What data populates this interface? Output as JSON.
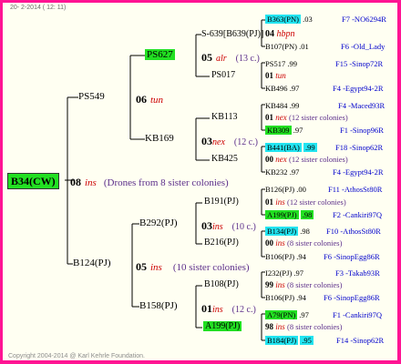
{
  "header": "20-  2-2014 ( 12: 11)",
  "copyright": "Copyright 2004-2014 @ Karl Kehrle Foundation.",
  "root": {
    "label": "B34(CW)",
    "gen": "08",
    "breed": "ins",
    "note": "(Drones from 8 sister colonies)"
  },
  "gen1": {
    "a": {
      "label": "PS549",
      "gen": "06",
      "breed": "tun"
    },
    "b": {
      "label": "B124(PJ)",
      "gen": "05",
      "breed": "ins",
      "note": "(10 sister colonies)"
    }
  },
  "gen2": {
    "ps627": {
      "label": "PS627",
      "gen": "05",
      "breed": "alr",
      "note": "(13 c.)"
    },
    "kb169": {
      "label": "KB169",
      "gen": "03",
      "breed": "nex",
      "note": "(12 c.)"
    },
    "b292": {
      "label": "B292(PJ)",
      "gen": "03",
      "breed": "ins",
      "note": "(10 c.)"
    },
    "b158": {
      "label": "B158(PJ)",
      "gen": "01",
      "breed": "ins",
      "note": "(12 c.)"
    }
  },
  "gen3": {
    "s639": {
      "label": "S-639[B639(PJ)]",
      "gen": "04",
      "breed": "hbpn"
    },
    "ps017": {
      "label": "PS017",
      "gen": "01",
      "breed": "tun"
    },
    "kb113": {
      "label": "KB113",
      "gen": "01",
      "breed": "nex",
      "note": "(12 sister colonies)"
    },
    "kb425": {
      "label": "KB425",
      "gen": "00",
      "breed": "nex",
      "note": "(12 sister colonies)"
    },
    "b191": {
      "label": "B191(PJ)",
      "gen": "01",
      "breed": "ins",
      "note": "(12 sister colonies)"
    },
    "b216": {
      "label": "B216(PJ)",
      "gen": "00",
      "breed": "ins",
      "note": "(8 sister colonies)"
    },
    "b108": {
      "label": "B108(PJ)",
      "gen": "99",
      "breed": "ins",
      "note": "(8 sister colonies)"
    },
    "a199": {
      "label": "A199(PJ)",
      "gen": "98",
      "breed": "ins",
      "note": "(8 sister colonies)"
    }
  },
  "leaves": [
    {
      "id": "B363(PN)",
      "year": ".03",
      "ref": "F7 -NO6294R",
      "hl": "cyan"
    },
    {
      "id": "B107(PN)",
      "year": ".01",
      "ref": "F6 -Old_Lady",
      "hl": ""
    },
    {
      "id": "PS517",
      "year": ".99",
      "ref": "F15 -Sinop72R",
      "hl": ""
    },
    {
      "id": "KB496",
      "year": ".97",
      "ref": "F4 -Egypt94-2R",
      "hl": ""
    },
    {
      "id": "KB484",
      "year": ".99",
      "ref": "F4 -Maced93R",
      "hl": ""
    },
    {
      "id": "KB309",
      "year": ".97",
      "ref": "F1 -Sinop96R",
      "hl": "green"
    },
    {
      "id": "B441(BA)",
      "year": ".99",
      "ref": "F18 -Sinop62R",
      "hl": "cyan"
    },
    {
      "id": "KB232",
      "year": ".97",
      "ref": "F4 -Egypt94-2R",
      "hl": ""
    },
    {
      "id": "B126(PJ)",
      "year": ".00",
      "ref": "F11 -AthosSt80R",
      "hl": ""
    },
    {
      "id": "A199(PJ)",
      "year": ".98",
      "ref": "F2 -Cankiri97Q",
      "hl": "green"
    },
    {
      "id": "B134(PJ)",
      "year": ".98",
      "ref": "F10 -AthosSt80R",
      "hl": "cyan"
    },
    {
      "id": "B106(PJ)",
      "year": ".94",
      "ref": "F6 -SinopEgg86R",
      "hl": ""
    },
    {
      "id": "I232(PJ)",
      "year": ".97",
      "ref": "F3 -Takab93R",
      "hl": ""
    },
    {
      "id": "B106(PJ)",
      "year": ".94",
      "ref": "F6 -SinopEgg86R",
      "hl": ""
    },
    {
      "id": "A79(PN)",
      "year": ".97",
      "ref": "F1 -Cankiri97Q",
      "hl": "green"
    },
    {
      "id": "B184(PJ)",
      "year": ".95",
      "ref": "F14 -Sinop62R",
      "hl": "cyan"
    }
  ]
}
